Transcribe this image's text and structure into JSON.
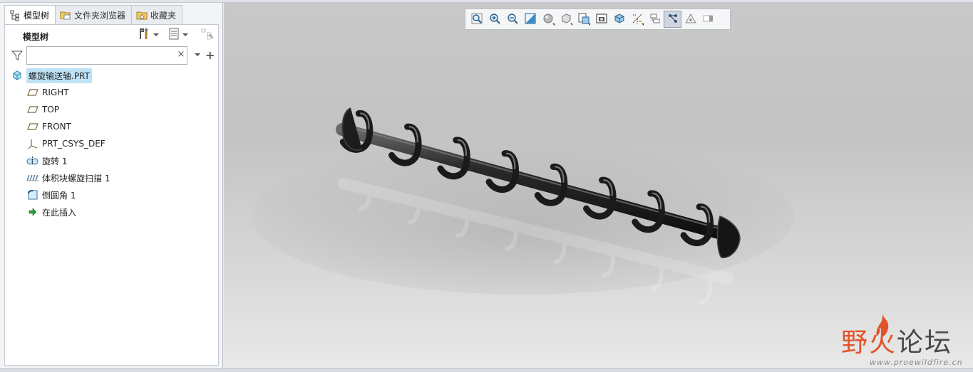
{
  "tabs": [
    {
      "label": "模型树",
      "icon": "model-tree-icon",
      "active": true
    },
    {
      "label": "文件夹浏览器",
      "icon": "folder-browser-icon",
      "active": false
    },
    {
      "label": "收藏夹",
      "icon": "favorites-icon",
      "active": false
    }
  ],
  "panel": {
    "title": "模型树",
    "settings_icon": "tools-icon",
    "show_icon": "list-settings-icon",
    "filter_icon": "funnel-icon",
    "search_value": "",
    "search_placeholder": "",
    "clear_label": "×",
    "add_label": "+"
  },
  "tree": [
    {
      "label": "螺旋输送轴.PRT",
      "icon": "part-icon"
    },
    {
      "label": "RIGHT",
      "icon": "datum-plane-icon"
    },
    {
      "label": "TOP",
      "icon": "datum-plane-icon"
    },
    {
      "label": "FRONT",
      "icon": "datum-plane-icon"
    },
    {
      "label": "PRT_CSYS_DEF",
      "icon": "coordinate-system-icon"
    },
    {
      "label": "旋转 1",
      "icon": "revolve-icon"
    },
    {
      "label": "体积块螺旋扫描 1",
      "icon": "helical-sweep-icon"
    },
    {
      "label": "倒圆角 1",
      "icon": "round-icon"
    },
    {
      "label": "在此插入",
      "icon": "insert-here-arrow-icon"
    }
  ],
  "view_toolbar": [
    "refit-icon",
    "zoom-in-icon",
    "zoom-out-icon",
    "repaint-icon",
    "display-style-icon",
    "saved-orientations-icon",
    "view-manager-icon",
    "perspective-view-icon",
    "section-icon",
    "datum-display-icon",
    "annotation-display-icon",
    "spin-center-icon",
    "point-display-icon",
    "simulation-display-icon"
  ],
  "watermark": {
    "title_a": "野火",
    "title_b": "论坛",
    "url": "www.proewildfire.cn"
  },
  "colors": {
    "selection": "#bfe2f7",
    "accent": "#e2552b"
  }
}
